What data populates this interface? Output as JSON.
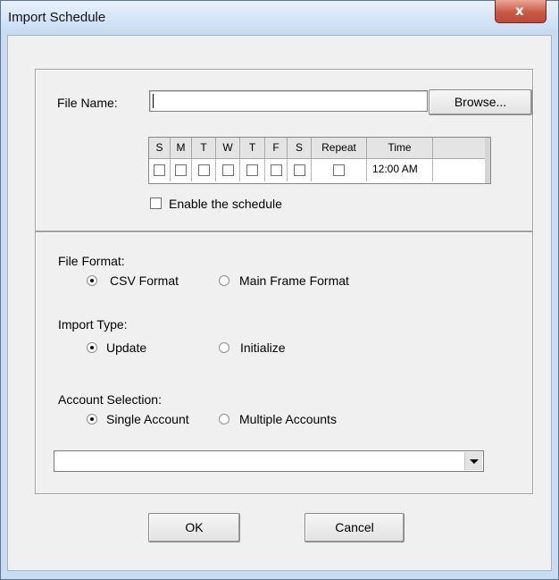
{
  "window": {
    "title": "Import Schedule",
    "close_symbol": "x"
  },
  "file": {
    "label": "File Name:",
    "value": "",
    "browse_label": "Browse..."
  },
  "schedule": {
    "columns": [
      "S",
      "M",
      "T",
      "W",
      "T",
      "F",
      "S",
      "Repeat",
      "Time"
    ],
    "days_checked": [
      false,
      false,
      false,
      false,
      false,
      false,
      false
    ],
    "repeat_checked": false,
    "time": "12:00 AM"
  },
  "enable": {
    "label": "Enable the schedule",
    "checked": false
  },
  "file_format": {
    "label": "File Format:",
    "options": [
      "CSV Format",
      "Main Frame Format"
    ],
    "selected": "CSV Format"
  },
  "import_type": {
    "label": "Import Type:",
    "options": [
      "Update",
      "Initialize"
    ],
    "selected": "Update"
  },
  "account_selection": {
    "label": "Account Selection:",
    "options": [
      "Single Account",
      "Multiple Accounts"
    ],
    "selected": "Single Account",
    "combo_value": ""
  },
  "buttons": {
    "ok": "OK",
    "cancel": "Cancel"
  }
}
